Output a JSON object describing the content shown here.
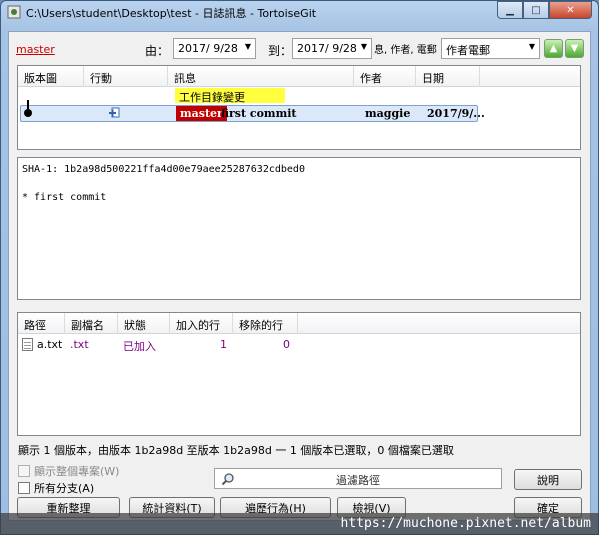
{
  "window": {
    "title": "C:\\Users\\student\\Desktop\\test - 日誌訊息 - TortoiseGit",
    "minimize": "▁",
    "maximize": "□",
    "close": "✕"
  },
  "toolbar": {
    "branch": "master",
    "from_label": "由：",
    "from_date": "2017/ 9/28",
    "to_label": "到：",
    "to_date": "2017/ 9/28",
    "filter_text": "息, 作者, 電郵",
    "filter_field": "作者電郵",
    "up_arrow": "▲",
    "down_arrow": "▼"
  },
  "log": {
    "columns": [
      "版本圖",
      "行動",
      "訊息",
      "作者",
      "日期"
    ],
    "working_dir_changes": "工作目錄變更",
    "commits": [
      {
        "ref": "master",
        "message": "first commit",
        "author": "maggie",
        "date": "2017/9/..."
      }
    ]
  },
  "message": {
    "sha_line": "SHA-1: 1b2a98d500221ffa4d00e79aee25287632cdbed0",
    "body": "* first commit"
  },
  "files": {
    "columns": [
      "路徑",
      "副檔名",
      "狀態",
      "加入的行",
      "移除的行"
    ],
    "rows": [
      {
        "path": "a.txt",
        "ext": ".txt",
        "status": "已加入",
        "added": "1",
        "removed": "0"
      }
    ]
  },
  "status_text": "顯示 1 個版本，由版本 1b2a98d 至版本 1b2a98d 一 1 個版本已選取，0 個檔案已選取",
  "options": {
    "show_whole_project": "顯示整個專案(W)",
    "all_branches": "所有分支(A)"
  },
  "path_filter_placeholder": "過濾路徑",
  "buttons": {
    "help": "說明",
    "refresh": "重新整理",
    "statistics": "統計資料(T)",
    "walk_behavior": "遍歷行為(H)",
    "view": "檢視(V)",
    "ok": "確定"
  },
  "watermark": "https://muchone.pixnet.net/album",
  "colors": {
    "branch_link": "#cc0000",
    "ref_badge": "#c00000",
    "wc_highlight": "#ffff40",
    "selection": "#dbe8f9"
  }
}
